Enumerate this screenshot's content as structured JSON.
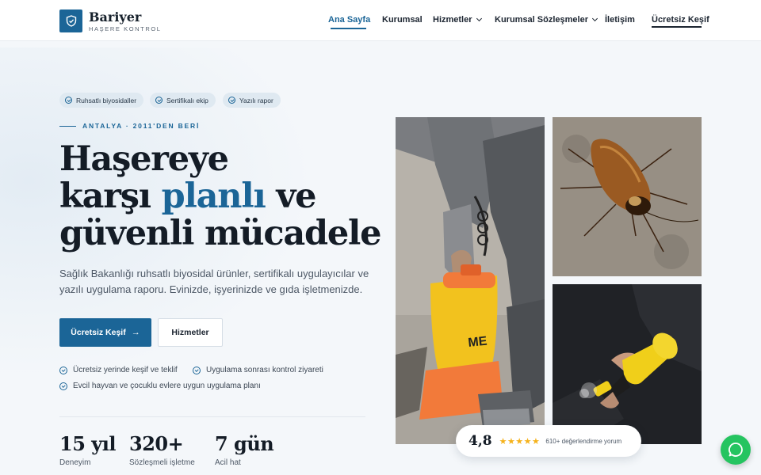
{
  "brand": {
    "name": "Bariyer",
    "tagline": "HAŞERE KONTROL",
    "icon": "shield-check-icon"
  },
  "nav": {
    "items": [
      {
        "label": "Ana Sayfa",
        "active": true
      },
      {
        "label": "Kurumsal"
      },
      {
        "label": "Hizmetler",
        "dropdown": true
      },
      {
        "label": "Kurumsal Sözleşmeler",
        "dropdown": true
      },
      {
        "label": "İletişim"
      }
    ],
    "cta": "Ücretsiz Keşif"
  },
  "hero": {
    "badges": [
      "Ruhsatlı biyosidaller",
      "Sertifikalı ekip",
      "Yazılı rapor"
    ],
    "eyebrow": "ANTALYA · 2011'DEN BERİ",
    "headline": {
      "line1": "Haşereye",
      "line2_pre": "karşı ",
      "line2_accent": "planlı",
      "line2_post": " ve",
      "line3": "güvenli mücadele"
    },
    "lead": "Sağlık Bakanlığı ruhsatlı biyosidal ürünler, sertifikalı uygulayıcılar ve yazılı uygulama raporu. Evinizde, işyerinizde ve gıda işletmenizde.",
    "primary_button": "Ücretsiz Keşif",
    "secondary_button": "Hizmetler",
    "features": [
      "Ücretsiz yerinde keşif ve teklif",
      "Uygulama sonrası kontrol ziyareti",
      "Evcil hayvan ve çocuklu evlere uygun uygulama planı"
    ],
    "stats": [
      {
        "value": "15 yıl",
        "label": "Deneyim"
      },
      {
        "value": "320+",
        "label": "Sözleşmeli işletme"
      },
      {
        "value": "7 gün",
        "label": "Acil hat"
      }
    ]
  },
  "rating": {
    "score": "4,8",
    "stars": 5,
    "text": "610+ değerlendirme yorum"
  },
  "colors": {
    "accent": "#1b6597",
    "star": "#f5b21b",
    "chat": "#25c460"
  }
}
